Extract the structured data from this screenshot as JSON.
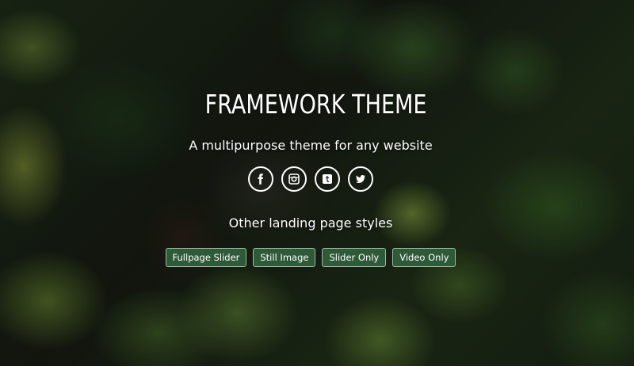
{
  "hero": {
    "title": "FRAMEWORK THEME",
    "subtitle": "A multipurpose theme for any website"
  },
  "social": [
    {
      "icon": "facebook-icon"
    },
    {
      "icon": "instagram-icon"
    },
    {
      "icon": "tumblr-icon"
    },
    {
      "icon": "twitter-icon"
    }
  ],
  "styles": {
    "heading": "Other landing page styles",
    "buttons": [
      "Fullpage Slider",
      "Still Image",
      "Slider Only",
      "Video Only"
    ]
  },
  "colors": {
    "button_bg": "#2e5a3a",
    "button_border": "#9fb8a4",
    "text": "#ffffff"
  }
}
